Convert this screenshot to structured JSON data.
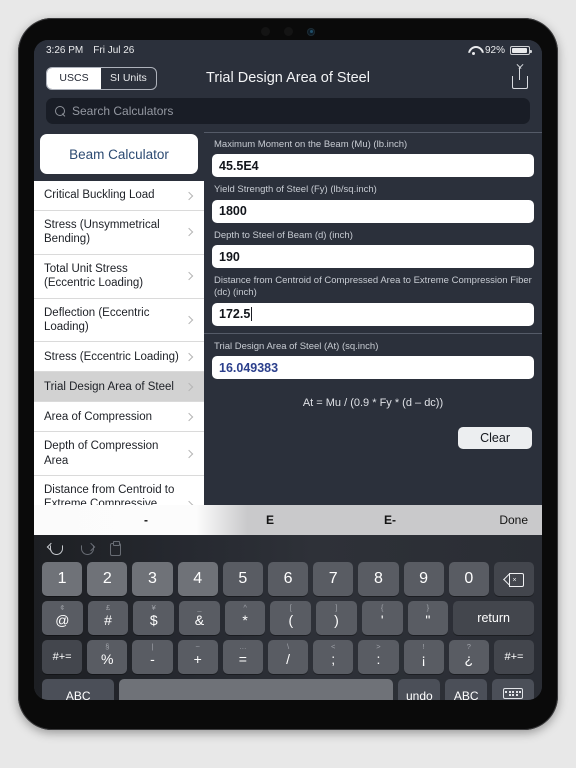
{
  "status_bar": {
    "time": "3:26 PM",
    "date": "Fri Jul 26",
    "battery_percent": "92%",
    "wifi_icon": "wifi-icon",
    "battery_icon": "battery-icon"
  },
  "header": {
    "title": "Trial Design Area of Steel",
    "segments": [
      {
        "label": "USCS",
        "active": true
      },
      {
        "label": "SI Units",
        "active": false
      }
    ],
    "share_icon": "share-icon"
  },
  "search": {
    "placeholder": "Search Calculators",
    "value": "",
    "icon": "search-icon"
  },
  "sidebar": {
    "primary_button": "Beam Calculator",
    "items": [
      {
        "label": "Critical Buckling Load",
        "selected": false
      },
      {
        "label": "Stress (Unsymmetrical Bending)",
        "selected": false
      },
      {
        "label": "Total Unit Stress (Eccentric Loading)",
        "selected": false
      },
      {
        "label": "Deflection (Eccentric Loading)",
        "selected": false
      },
      {
        "label": "Stress (Eccentric Loading)",
        "selected": false
      },
      {
        "label": "Trial Design Area of Steel",
        "selected": true
      },
      {
        "label": "Area of Compression",
        "selected": false
      },
      {
        "label": "Depth of Compression Area",
        "selected": false
      },
      {
        "label": "Distance from Centroid to Extreme Compressive Fiber",
        "selected": false
      }
    ]
  },
  "form": {
    "fields": [
      {
        "label": "Maximum Moment on the Beam (Mu) (lb.inch)",
        "value": "45.5E4",
        "focused": false
      },
      {
        "label": "Yield Strength of Steel (Fy) (lb/sq.inch)",
        "value": "1800",
        "focused": false
      },
      {
        "label": "Depth to Steel of Beam (d) (inch)",
        "value": "190",
        "focused": false
      },
      {
        "label": "Distance from Centroid of Compressed Area to Extreme Compression Fiber (dc) (inch)",
        "value": "172.5",
        "focused": true
      }
    ],
    "result": {
      "label": "Trial Design Area of Steel (At) (sq.inch)",
      "value": "16.049383"
    },
    "formula": "At = Mu / (0.9 * Fy * (d – dc))",
    "clear_label": "Clear"
  },
  "accessory_bar": {
    "minus": "-",
    "exp": "E",
    "exp_neg": "E-",
    "done": "Done"
  },
  "keyboard": {
    "toolbar_icons": [
      "undo-icon",
      "redo-icon",
      "paste-icon"
    ],
    "row1": [
      {
        "main": "1"
      },
      {
        "main": "2"
      },
      {
        "main": "3"
      },
      {
        "main": "4"
      },
      {
        "main": "5"
      },
      {
        "main": "6"
      },
      {
        "main": "7"
      },
      {
        "main": "8"
      },
      {
        "main": "9"
      },
      {
        "main": "0"
      }
    ],
    "backspace_icon": "backspace-icon",
    "row2": [
      {
        "sup": "¢",
        "main": "@"
      },
      {
        "sup": "£",
        "main": "#"
      },
      {
        "sup": "¥",
        "main": "$"
      },
      {
        "sup": "_",
        "main": "&"
      },
      {
        "sup": "^",
        "main": "*"
      },
      {
        "sup": "[",
        "main": "("
      },
      {
        "sup": "]",
        "main": ")"
      },
      {
        "sup": "{",
        "main": "'"
      },
      {
        "sup": "}",
        "main": "\""
      }
    ],
    "return_label": "return",
    "row3": [
      {
        "sup": "§",
        "main": "%"
      },
      {
        "sup": "|",
        "main": "-"
      },
      {
        "sup": "~",
        "main": "+"
      },
      {
        "sup": "…",
        "main": "="
      },
      {
        "sup": "\\",
        "main": "/"
      },
      {
        "sup": "<",
        "main": ";"
      },
      {
        "sup": ">",
        "main": ":"
      },
      {
        "sup": "!",
        "main": "¡"
      },
      {
        "sup": "?",
        "main": "¿"
      }
    ],
    "symbol_left": "#+=",
    "symbol_right": "#+=",
    "row4": {
      "abc_left": "ABC",
      "space": "",
      "undo": "undo",
      "abc_right": "ABC",
      "dismiss_icon": "keyboard-dismiss-icon"
    }
  }
}
